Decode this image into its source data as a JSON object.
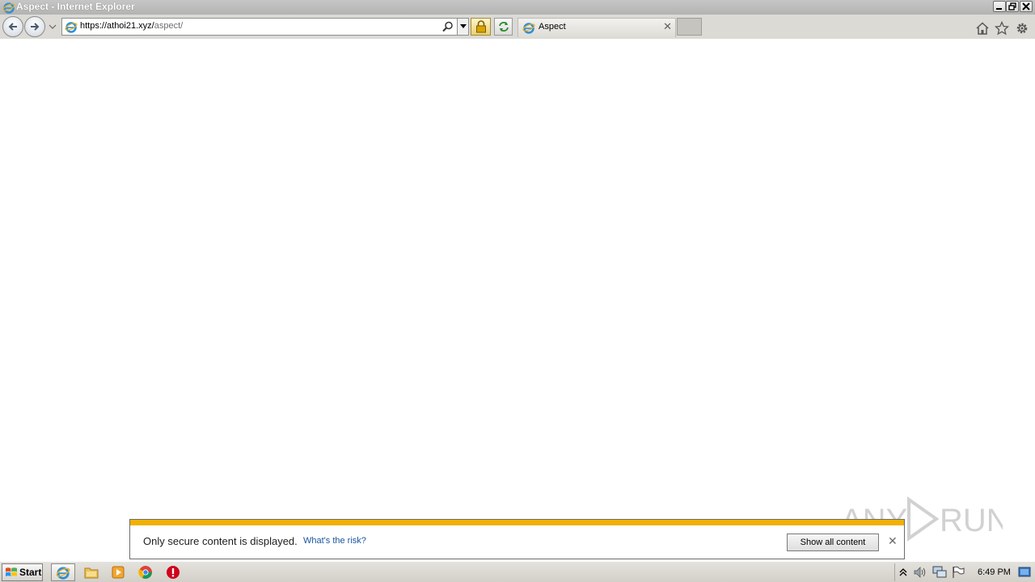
{
  "window": {
    "title": "Aspect - Internet Explorer"
  },
  "address_bar": {
    "url_host": "https://athoi21.xyz/",
    "url_path": "aspect/"
  },
  "tab": {
    "label": "Aspect"
  },
  "notification": {
    "message": "Only secure content is displayed.",
    "risk_link": "What's the risk?",
    "button_label": "Show all content"
  },
  "taskbar": {
    "start_label": "Start",
    "clock": "6:49 PM"
  },
  "watermark": {
    "text": "ANY RUN"
  },
  "colors": {
    "notification_stripe": "#f0b100",
    "link": "#1a55a0"
  }
}
